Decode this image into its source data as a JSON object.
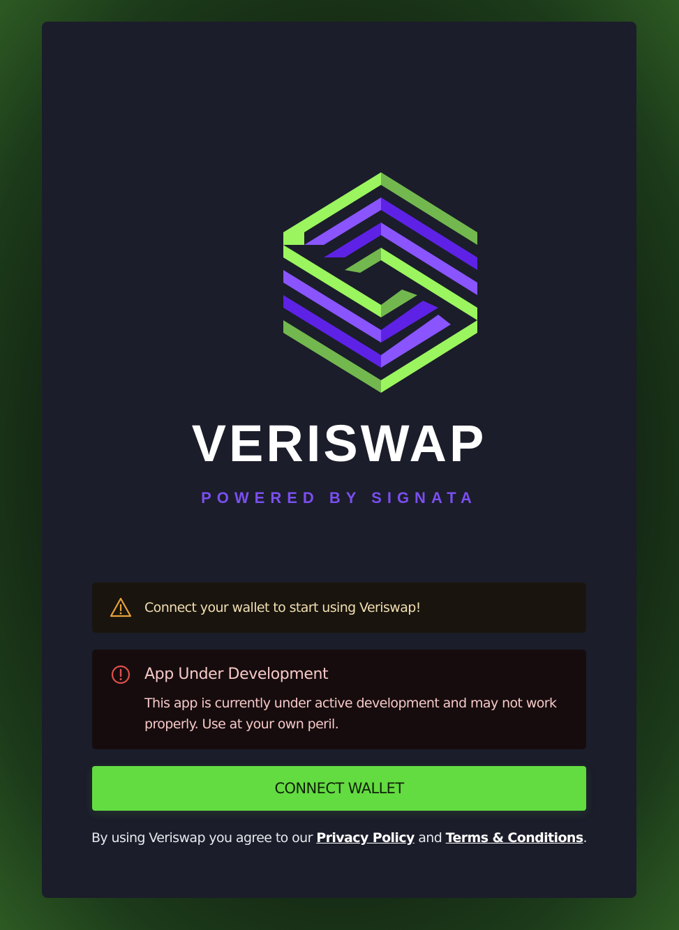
{
  "brand": {
    "name": "VERISWAP",
    "tagline": "POWERED BY SIGNATA",
    "logo_icon": "veriswap-hexagon-logo",
    "colors": {
      "green": "#9bf55f",
      "green_dark": "#73b84f",
      "purple": "#8a55ff",
      "purple_dark": "#5e22e6"
    }
  },
  "alerts": {
    "warning": {
      "icon": "warning-triangle-icon",
      "text": "Connect your wallet to start using Veriswap!"
    },
    "error": {
      "icon": "error-circle-icon",
      "title": "App Under Development",
      "body": "This app is currently under active development and may not work properly. Use at your own peril."
    }
  },
  "actions": {
    "connect_label": "CONNECT WALLET"
  },
  "footer": {
    "prefix": "By using Veriswap you agree to our ",
    "privacy_label": "Privacy Policy",
    "middle": " and ",
    "terms_label": "Terms & Conditions",
    "suffix": "."
  },
  "colors": {
    "card_bg": "#1b1d2a",
    "button_bg": "#63dc41",
    "warning_accent": "#e8a23a",
    "error_accent": "#e0504a"
  }
}
